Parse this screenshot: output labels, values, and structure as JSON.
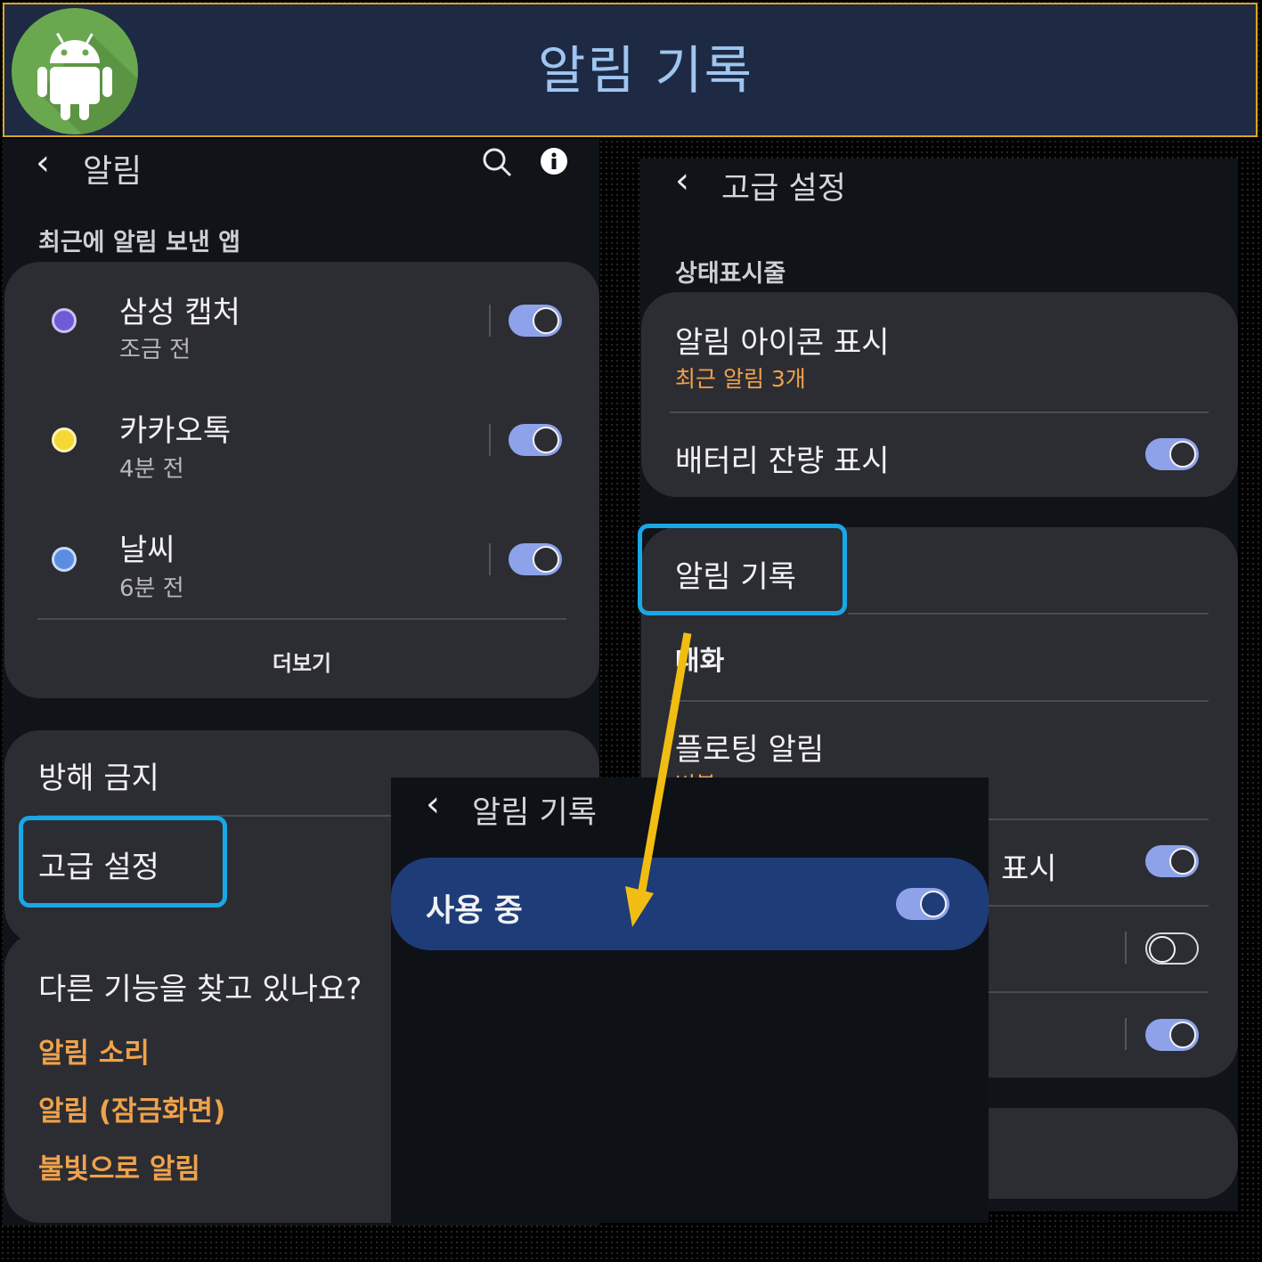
{
  "banner": {
    "title": "알림 기록"
  },
  "screen1": {
    "header_title": "알림",
    "recent_section": "최근에 알림 보낸 앱",
    "apps": [
      {
        "name": "삼성 캡처",
        "time": "조금 전",
        "enabled": true,
        "icon": "capture-icon"
      },
      {
        "name": "카카오톡",
        "time": "4분 전",
        "enabled": true,
        "icon": "kakaotalk-icon"
      },
      {
        "name": "날씨",
        "time": "6분 전",
        "enabled": true,
        "icon": "weather-icon"
      }
    ],
    "more_label": "더보기",
    "dnd_label": "방해 금지",
    "advanced_label": "고급 설정",
    "looking_title": "다른 기능을 찾고 있나요?",
    "links": [
      "알림 소리",
      "알림 (잠금화면)",
      "불빛으로 알림"
    ]
  },
  "screen2": {
    "header_title": "고급 설정",
    "status_section": "상태표시줄",
    "notif_icon_label": "알림 아이콘 표시",
    "notif_icon_value": "최근 알림 3개",
    "battery_label": "배터리 잔량 표시",
    "battery_enabled": true,
    "history_label": "알림 기록",
    "conversation_label": "대화",
    "floating_label": "플로팅 알림",
    "floating_value": "버블",
    "partial_label": "표시",
    "toggle_rows": [
      true,
      false,
      true
    ]
  },
  "screen3": {
    "header_title": "알림 기록",
    "in_use_label": "사용 중",
    "in_use_enabled": true
  },
  "colors": {
    "accent_toggle": "#8ea2ea",
    "highlight": "#1aa7e6",
    "link_orange": "#f0a24a",
    "arrow": "#f2bd12",
    "banner_bg": "#1e2a44",
    "banner_border": "#d9a521"
  }
}
